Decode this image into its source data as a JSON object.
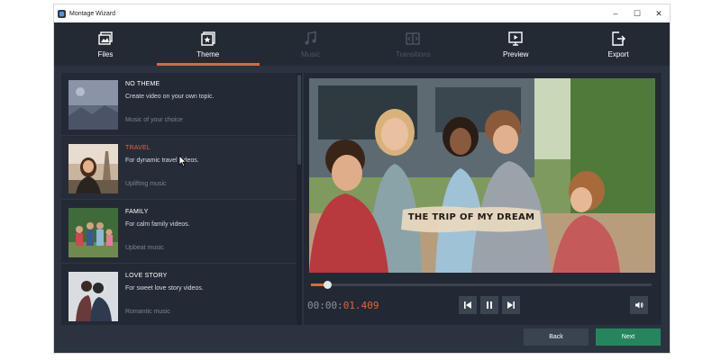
{
  "window": {
    "title": "Montage Wizard"
  },
  "title_controls": {
    "minimize": "–",
    "maximize": "☐",
    "close": "✕"
  },
  "tabs": [
    {
      "label": "Files",
      "icon": "images-icon",
      "state": "normal"
    },
    {
      "label": "Theme",
      "icon": "star-frame-icon",
      "state": "active"
    },
    {
      "label": "Music",
      "icon": "music-note-icon",
      "state": "disabled"
    },
    {
      "label": "Transitions",
      "icon": "transitions-icon",
      "state": "disabled"
    },
    {
      "label": "Preview",
      "icon": "play-screen-icon",
      "state": "normal"
    },
    {
      "label": "Export",
      "icon": "export-icon",
      "state": "normal"
    }
  ],
  "themes": [
    {
      "name": "NO THEME",
      "description": "Create video on your own topic.",
      "music": "Music of your choice",
      "selected": false
    },
    {
      "name": "TRAVEL",
      "description": "For dynamic travel videos.",
      "music": "Uplifting music",
      "selected": true
    },
    {
      "name": "FAMILY",
      "description": "For calm family videos.",
      "music": "Upbeat music",
      "selected": false
    },
    {
      "name": "LOVE STORY",
      "description": "For sweet love story videos.",
      "music": "Romantic music",
      "selected": false
    }
  ],
  "preview": {
    "overlay_title": "THE TRIP OF MY DREAM",
    "timecode_dim": "00:00:",
    "timecode_active": "01.409",
    "progress": 0.047
  },
  "footer": {
    "back_label": "Back",
    "next_label": "Next"
  },
  "colors": {
    "accent": "#e2643e",
    "next_button": "#27855e",
    "background": "#2b3340"
  }
}
